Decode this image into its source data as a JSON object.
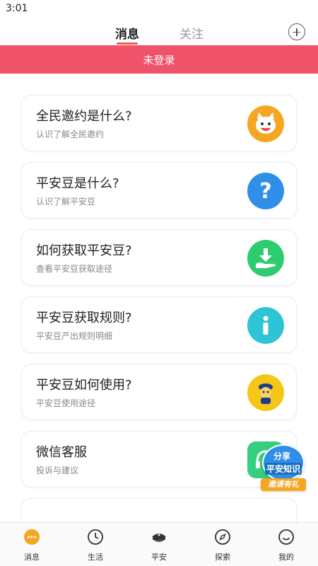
{
  "status_bar": {
    "time": "3:01"
  },
  "header": {
    "tabs": [
      {
        "label": "消息",
        "active": true
      },
      {
        "label": "关注",
        "active": false
      }
    ],
    "add_icon": "plus-circle-icon"
  },
  "banner": {
    "text": "未登录",
    "color": "#f0526a"
  },
  "cards": [
    {
      "title": "全民邀约是什么?",
      "subtitle": "认识了解全民邀约",
      "icon": "cat-mascot-icon",
      "icon_color": "#f5a623"
    },
    {
      "title": "平安豆是什么?",
      "subtitle": "认识了解平安豆",
      "icon": "question-mark-icon",
      "icon_color": "#2f8fe8"
    },
    {
      "title": "如何获取平安豆?",
      "subtitle": "查看平安豆获取途径",
      "icon": "download-hand-icon",
      "icon_color": "#2ecc71"
    },
    {
      "title": "平安豆获取规则?",
      "subtitle": "平安豆产出规则明细",
      "icon": "info-icon",
      "icon_color": "#2ec4d6"
    },
    {
      "title": "平安豆如何使用?",
      "subtitle": "平安豆使用途径",
      "icon": "police-mascot-icon",
      "icon_color": "#f5c518"
    },
    {
      "title": "微信客服",
      "subtitle": "投诉与建议",
      "icon": "headset-icon",
      "icon_color": "#35d07f"
    }
  ],
  "floating_badge": {
    "line1": "分享",
    "line2": "平安知识",
    "ribbon": "邀请有礼"
  },
  "bottom_nav": [
    {
      "label": "消息",
      "icon": "chat-bubble-icon",
      "active": true
    },
    {
      "label": "生活",
      "icon": "clock-icon",
      "active": false
    },
    {
      "label": "平安",
      "icon": "police-cap-icon",
      "active": false
    },
    {
      "label": "探索",
      "icon": "compass-icon",
      "active": false
    },
    {
      "label": "我的",
      "icon": "smiley-icon",
      "active": false
    }
  ]
}
